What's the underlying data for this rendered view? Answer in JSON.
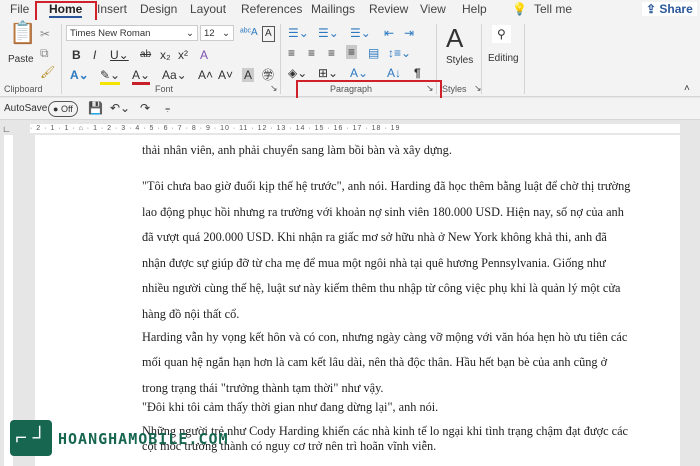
{
  "tabs": [
    "File",
    "Home",
    "Insert",
    "Design",
    "Layout",
    "References",
    "Mailings",
    "Review",
    "View",
    "Help"
  ],
  "tell_me": "Tell me",
  "share": "Share",
  "font": {
    "name": "Times New Roman",
    "size": "12"
  },
  "groups": {
    "clipboard": "Clipboard",
    "font": "Font",
    "paragraph": "Paragraph",
    "styles": "Styles"
  },
  "paste": "Paste",
  "styles_btn": "Styles",
  "editing": "Editing",
  "autosave": {
    "label": "AutoSave",
    "state": "Off"
  },
  "ruler": "· 2 · 1 · 1 · ⌂ · 1 · 2 · 3 · 4 · 5 · 6 · 7 · 8 · 9 · 10 · 11 · 12 · 13 · 14 · 15 · 16 · 17 · 18 · 19",
  "doc_lines": [
    "thải nhân viên, anh phải chuyển sang làm bồi bàn và xây dựng.",
    "\"Tôi chưa bao giờ đuổi kịp thế hệ trước\", anh nói. Harding đã học thêm bằng luật để chờ thị trường",
    "lao động phục hồi nhưng ra trường với khoản nợ sinh viên 180.000 USD. Hiện nay, số nợ của anh",
    "đã vượt quá 200.000 USD. Khi nhận ra giấc mơ sở hữu nhà ở New York không khả thi, anh đã",
    "nhận được sự giúp đỡ từ cha mẹ để mua một ngôi nhà tại quê hương Pennsylvania. Giống như",
    "nhiều người cùng thế hệ, luật sư này kiếm thêm thu nhập từ công việc phụ khi là quản lý một cửa",
    "hàng đồ nội thất cổ.",
    "Harding vẫn hy vọng kết hôn và có con, nhưng ngày càng vỡ mộng với văn hóa hẹn hò ưu tiên các",
    "mối quan hệ ngắn hạn hơn là cam kết lâu dài, nên thà độc thân. Hầu hết bạn bè của anh cũng ở",
    "trong trạng thái \"trưởng thành tạm thời\" như vậy.",
    "\"Đôi khi tôi cảm thấy thời gian như đang dừng lại\", anh nói.",
    "Những người trẻ như Cody Harding khiến các nhà kinh tế lo ngại khi tình trạng chậm đạt được các",
    "cột mốc trưởng thành có nguy cơ trở nên trì hoãn vĩnh viễn."
  ],
  "watermark": "HOANGHAMOBILE.COM",
  "colors": {
    "highlight_box": "#d0202a",
    "watermark": "#1a8a6a"
  }
}
